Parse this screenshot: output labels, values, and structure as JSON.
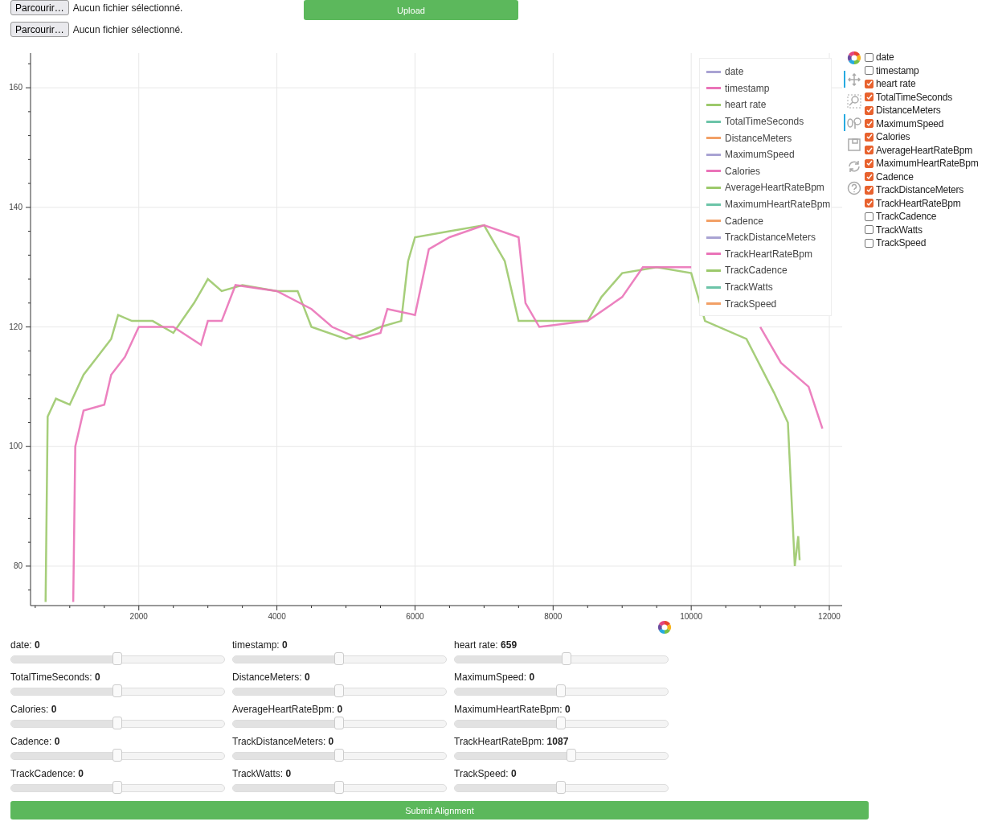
{
  "uploads": [
    {
      "button": "Parcourir…",
      "status": "Aucun fichier sélectionné."
    },
    {
      "button": "Parcourir…",
      "status": "Aucun fichier sélectionné."
    }
  ],
  "upload_button": "Upload",
  "plot": {
    "chart_data": {
      "type": "line",
      "xlim": [
        432,
        12186
      ],
      "ylim": [
        73.4,
        165.8
      ],
      "grid": true,
      "xticks": [
        2000,
        4000,
        6000,
        8000,
        10000,
        12000
      ],
      "yticks": [
        80,
        100,
        120,
        140,
        160
      ],
      "series": [
        {
          "color": "#9cc96b",
          "x": [
            650,
            680,
            800,
            1000,
            1200,
            1400,
            1600,
            1700,
            1900,
            2200,
            2500,
            2800,
            3000,
            3200,
            3500,
            4000,
            4300,
            4500,
            5000,
            5300,
            5500,
            5800,
            5900,
            6000,
            6500,
            7000,
            7300,
            7500,
            8000,
            8500,
            8700,
            9000,
            9500,
            10000,
            10200,
            10800,
            11200,
            11400,
            11500,
            11550,
            11570
          ],
          "values": [
            74,
            105,
            108,
            107,
            112,
            115,
            118,
            122,
            121,
            121,
            119,
            124,
            128,
            126,
            127,
            126,
            126,
            120,
            118,
            119,
            120,
            121,
            131,
            135,
            136,
            137,
            131,
            121,
            121,
            121,
            125,
            129,
            130,
            129,
            121,
            118,
            109,
            104,
            80,
            85,
            81
          ]
        },
        {
          "color": "#ea73b8",
          "x": [
            1050,
            1080,
            1200,
            1500,
            1600,
            1800,
            2000,
            2500,
            2900,
            3000,
            3200,
            3400,
            4000,
            4500,
            4800,
            5200,
            5500,
            5600,
            6000,
            6200,
            6500,
            7000,
            7500,
            7600,
            7800,
            8500,
            9000,
            9300,
            10000,
            10400,
            11000,
            11300,
            11700,
            11900
          ],
          "values": [
            74,
            100,
            106,
            107,
            112,
            115,
            120,
            120,
            117,
            121,
            121,
            127,
            126,
            123,
            120,
            118,
            119,
            123,
            122,
            133,
            135,
            137,
            135,
            124,
            120,
            121,
            125,
            130,
            130,
            null,
            120,
            114,
            110,
            103
          ]
        }
      ]
    },
    "legend": [
      {
        "label": "date",
        "color": "#a9a3d3"
      },
      {
        "label": "timestamp",
        "color": "#ea73b8"
      },
      {
        "label": "heart rate",
        "color": "#9cc96b"
      },
      {
        "label": "TotalTimeSeconds",
        "color": "#6cc4a8"
      },
      {
        "label": "DistanceMeters",
        "color": "#f2a066"
      },
      {
        "label": "MaximumSpeed",
        "color": "#a9a3d3"
      },
      {
        "label": "Calories",
        "color": "#ea73b8"
      },
      {
        "label": "AverageHeartRateBpm",
        "color": "#9cc96b"
      },
      {
        "label": "MaximumHeartRateBpm",
        "color": "#6cc4a8"
      },
      {
        "label": "Cadence",
        "color": "#f2a066"
      },
      {
        "label": "TrackDistanceMeters",
        "color": "#a9a3d3"
      },
      {
        "label": "TrackHeartRateBpm",
        "color": "#ea73b8"
      },
      {
        "label": "TrackCadence",
        "color": "#9cc96b"
      },
      {
        "label": "TrackWatts",
        "color": "#6cc4a8"
      },
      {
        "label": "TrackSpeed",
        "color": "#f2a066"
      }
    ]
  },
  "toolbar": [
    {
      "kind": "logo",
      "selected": false
    },
    {
      "kind": "pan",
      "selected": true
    },
    {
      "kind": "boxzoom",
      "selected": false
    },
    {
      "kind": "hover",
      "selected": true
    },
    {
      "kind": "save",
      "selected": false
    },
    {
      "kind": "reset",
      "selected": false
    },
    {
      "kind": "help",
      "selected": false
    }
  ],
  "columns": [
    {
      "label": "date",
      "checked": false
    },
    {
      "label": "timestamp",
      "checked": false
    },
    {
      "label": "heart rate",
      "checked": true
    },
    {
      "label": "TotalTimeSeconds",
      "checked": true
    },
    {
      "label": "DistanceMeters",
      "checked": true
    },
    {
      "label": "MaximumSpeed",
      "checked": true
    },
    {
      "label": "Calories",
      "checked": true
    },
    {
      "label": "AverageHeartRateBpm",
      "checked": true
    },
    {
      "label": "MaximumHeartRateBpm",
      "checked": true
    },
    {
      "label": "Cadence",
      "checked": true
    },
    {
      "label": "TrackDistanceMeters",
      "checked": true
    },
    {
      "label": "TrackHeartRateBpm",
      "checked": true
    },
    {
      "label": "TrackCadence",
      "checked": false
    },
    {
      "label": "TrackWatts",
      "checked": false
    },
    {
      "label": "TrackSpeed",
      "checked": false
    }
  ],
  "sliders": [
    {
      "label": "date:",
      "value": "0",
      "level": 0.5
    },
    {
      "label": "timestamp:",
      "value": "0",
      "level": 0.5
    },
    {
      "label": "heart rate:",
      "value": "659",
      "level": 0.53
    },
    {
      "label": "TotalTimeSeconds:",
      "value": "0",
      "level": 0.5
    },
    {
      "label": "DistanceMeters:",
      "value": "0",
      "level": 0.5
    },
    {
      "label": "MaximumSpeed:",
      "value": "0",
      "level": 0.5
    },
    {
      "label": "Calories:",
      "value": "0",
      "level": 0.5
    },
    {
      "label": "AverageHeartRateBpm:",
      "value": "0",
      "level": 0.5
    },
    {
      "label": "MaximumHeartRateBpm:",
      "value": "0",
      "level": 0.5
    },
    {
      "label": "Cadence:",
      "value": "0",
      "level": 0.5
    },
    {
      "label": "TrackDistanceMeters:",
      "value": "0",
      "level": 0.5
    },
    {
      "label": "TrackHeartRateBpm:",
      "value": "1087",
      "level": 0.55
    },
    {
      "label": "TrackCadence:",
      "value": "0",
      "level": 0.5
    },
    {
      "label": "TrackWatts:",
      "value": "0",
      "level": 0.5
    },
    {
      "label": "TrackSpeed:",
      "value": "0",
      "level": 0.5
    }
  ],
  "submit_button": "Submit Alignment"
}
